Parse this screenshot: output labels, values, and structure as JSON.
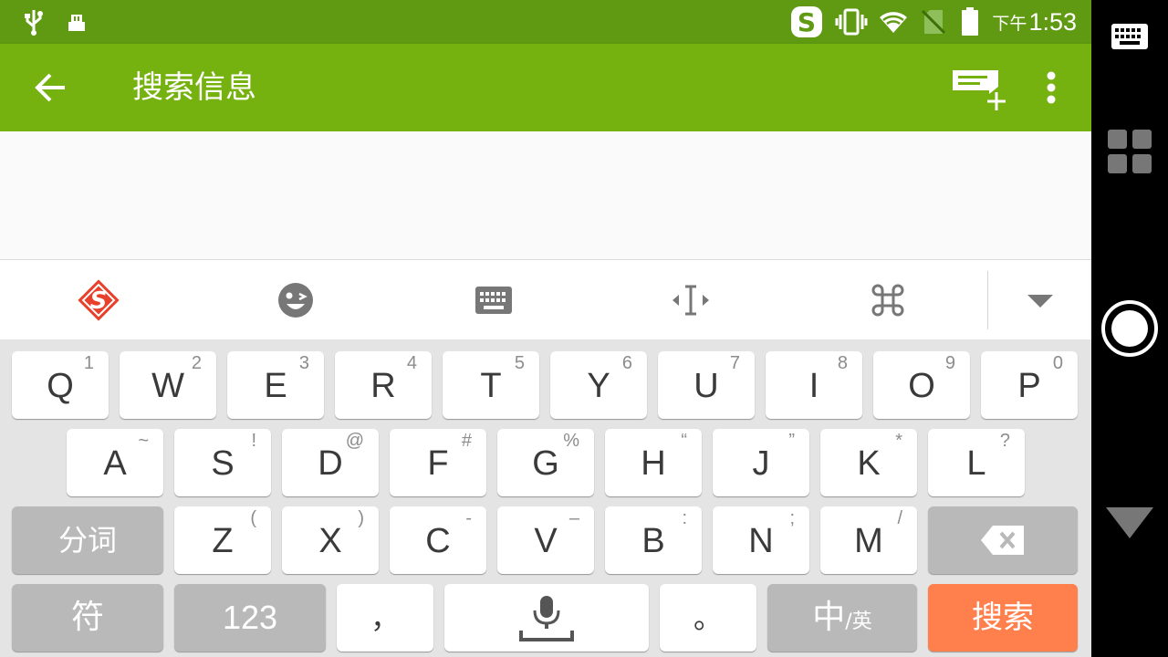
{
  "status_bar": {
    "time_prefix": "下午",
    "time": "1:53",
    "icons": [
      "usb-icon",
      "sd-card-icon",
      "sogou-notification-icon",
      "vibrate-icon",
      "wifi-icon",
      "no-sim-icon",
      "battery-icon"
    ]
  },
  "app_bar": {
    "title": "搜索信息",
    "back_icon": "arrow-left-icon",
    "new_message_icon": "new-message-icon",
    "overflow_icon": "more-vert-icon"
  },
  "ime_toolbar": {
    "items": [
      "sogou-logo-icon",
      "emoji-icon",
      "keyboard-icon",
      "cursor-move-icon",
      "command-icon",
      "collapse-icon"
    ]
  },
  "keyboard": {
    "row1": [
      {
        "key": "Q",
        "hint": "1"
      },
      {
        "key": "W",
        "hint": "2"
      },
      {
        "key": "E",
        "hint": "3"
      },
      {
        "key": "R",
        "hint": "4"
      },
      {
        "key": "T",
        "hint": "5"
      },
      {
        "key": "Y",
        "hint": "6"
      },
      {
        "key": "U",
        "hint": "7"
      },
      {
        "key": "I",
        "hint": "8"
      },
      {
        "key": "O",
        "hint": "9"
      },
      {
        "key": "P",
        "hint": "0"
      }
    ],
    "row2": [
      {
        "key": "A",
        "hint": "~"
      },
      {
        "key": "S",
        "hint": "!"
      },
      {
        "key": "D",
        "hint": "@"
      },
      {
        "key": "F",
        "hint": "#"
      },
      {
        "key": "G",
        "hint": "%"
      },
      {
        "key": "H",
        "hint": "“"
      },
      {
        "key": "J",
        "hint": "”"
      },
      {
        "key": "K",
        "hint": "*"
      },
      {
        "key": "L",
        "hint": "?"
      }
    ],
    "row3": [
      {
        "key": "Z",
        "hint": "("
      },
      {
        "key": "X",
        "hint": ")"
      },
      {
        "key": "C",
        "hint": "-"
      },
      {
        "key": "V",
        "hint": "–"
      },
      {
        "key": "B",
        "hint": ":"
      },
      {
        "key": "N",
        "hint": ";"
      },
      {
        "key": "M",
        "hint": "/"
      }
    ],
    "segment_label": "分词",
    "symbol_label": "符",
    "numbers_label": "123",
    "comma_label": "，",
    "period_label": "。",
    "lang_main": "中",
    "lang_alt": "/英",
    "search_label": "搜索"
  },
  "colors": {
    "status_bar": "#5f9a12",
    "app_bar": "#76b20f",
    "search_key": "#ff7f4d",
    "sogou_red": "#e8402a"
  }
}
